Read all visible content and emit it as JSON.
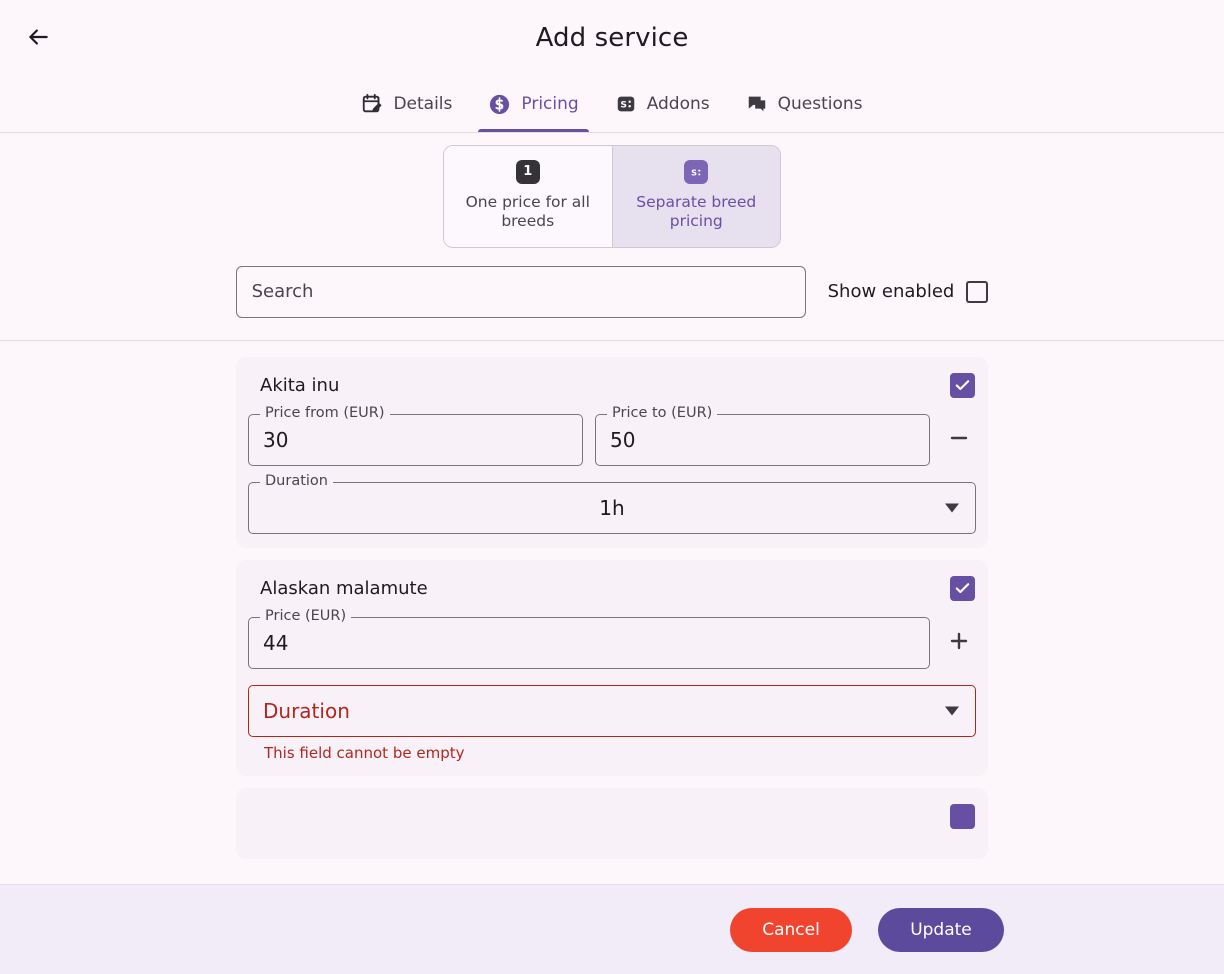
{
  "header": {
    "back_icon": "arrow-left-icon",
    "title": "Add service"
  },
  "tabs": [
    {
      "label": "Details",
      "icon": "calendar-edit-icon",
      "active": false
    },
    {
      "label": "Pricing",
      "icon": "dollar-circle-icon",
      "active": true
    },
    {
      "label": "Addons",
      "icon": "price-tag-icon",
      "active": false
    },
    {
      "label": "Questions",
      "icon": "chat-bubble-icon",
      "active": false
    }
  ],
  "pricing_mode": {
    "options": [
      {
        "label": "One price for all breeds",
        "badge": "1",
        "badge_icon": "number-one-badge",
        "selected": false
      },
      {
        "label": "Separate breed pricing",
        "badge": "$",
        "badge_icon": "price-list-badge",
        "selected": true
      }
    ]
  },
  "search": {
    "value": "",
    "placeholder": "Search",
    "icon": "search-input"
  },
  "show_enabled": {
    "label": "Show enabled",
    "checked": false
  },
  "breeds": [
    {
      "name": "Akita inu",
      "enabled": true,
      "range_pricing": true,
      "price_from_label": "Price from (EUR)",
      "price_from_value": "30",
      "price_to_label": "Price to (EUR)",
      "price_to_value": "50",
      "stepper": "minus",
      "duration_label": "Duration",
      "duration_value": "1h",
      "duration_error": "",
      "has_error": false
    },
    {
      "name": "Alaskan malamute",
      "enabled": true,
      "range_pricing": false,
      "price_label": "Price (EUR)",
      "price_value": "44",
      "stepper": "plus",
      "duration_label": "Duration",
      "duration_value": "",
      "duration_error": "This field cannot be empty",
      "has_error": true
    }
  ],
  "footer": {
    "cancel_label": "Cancel",
    "update_label": "Update"
  },
  "colors": {
    "accent": "#6750a4",
    "error": "#b3261e",
    "cancel": "#f0442e",
    "update": "#5c4b9c",
    "page_bg": "#fdf7fc",
    "card_bg": "#f8f2f8",
    "footer_bg": "#f1ecf7"
  }
}
